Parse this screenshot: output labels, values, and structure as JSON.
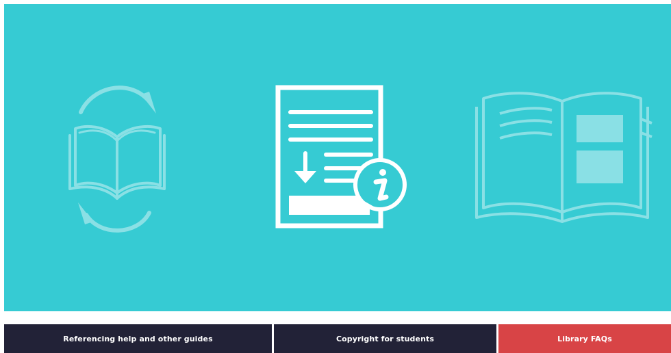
{
  "colors": {
    "hero_background": "#36cbd3",
    "icon_white": "#ffffff",
    "nav_dark": "#222237",
    "nav_accent": "#d84446"
  },
  "hero": {
    "icons": [
      "book-exchange-icon",
      "document-info-icon",
      "open-book-icon"
    ]
  },
  "nav": {
    "items": [
      {
        "label": "Referencing help and other guides",
        "color": "#222237"
      },
      {
        "label": "Copyright for students",
        "color": "#222237"
      },
      {
        "label": "Library FAQs",
        "color": "#d84446"
      }
    ]
  }
}
